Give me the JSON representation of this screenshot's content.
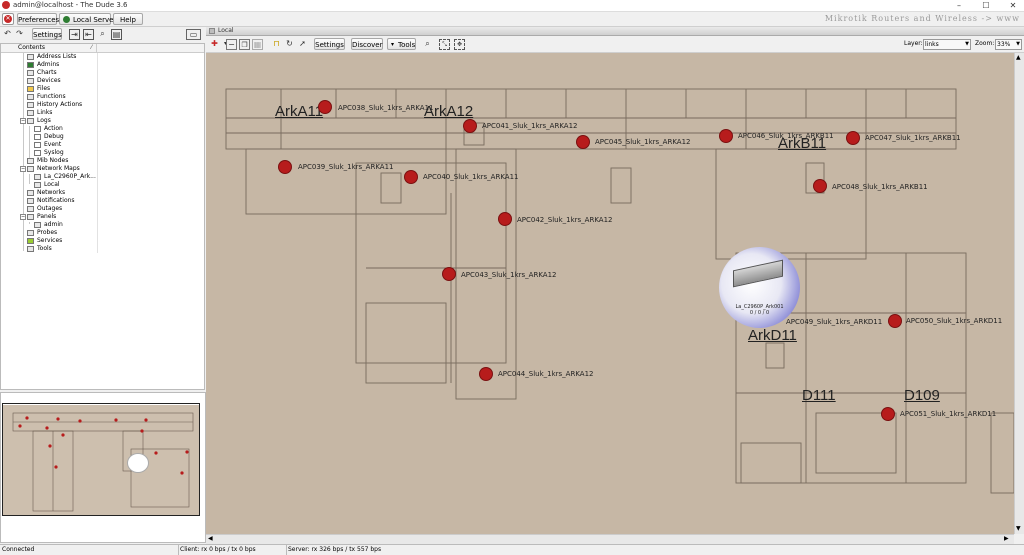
{
  "window": {
    "title": "admin@localhost - The Dude 3.6",
    "controls": [
      "–",
      "☐",
      "✕"
    ]
  },
  "toolbar": {
    "preferences": "Preferences",
    "local_server": "Local Server",
    "help": "Help",
    "brand": "Mikrotik Routers and Wireless -> www"
  },
  "left_toolbar": {
    "settings": "Settings"
  },
  "tree": {
    "header": "Contents",
    "items": [
      {
        "label": "Address Lists",
        "level": 1,
        "icon": "list-icon"
      },
      {
        "label": "Admins",
        "level": 1,
        "icon": "admin-icon"
      },
      {
        "label": "Charts",
        "level": 1,
        "icon": "chart-icon"
      },
      {
        "label": "Devices",
        "level": 1,
        "icon": "device-icon"
      },
      {
        "label": "Files",
        "level": 1,
        "icon": "folder-icon"
      },
      {
        "label": "Functions",
        "level": 1,
        "icon": "list-icon"
      },
      {
        "label": "History Actions",
        "level": 1,
        "icon": "list-icon"
      },
      {
        "label": "Links",
        "level": 1,
        "icon": "list-icon"
      },
      {
        "label": "Logs",
        "level": 1,
        "icon": "list-icon",
        "expander": "−"
      },
      {
        "label": "Action",
        "level": 2,
        "icon": "log-icon"
      },
      {
        "label": "Debug",
        "level": 2,
        "icon": "log-icon"
      },
      {
        "label": "Event",
        "level": 2,
        "icon": "log-icon"
      },
      {
        "label": "Syslog",
        "level": 2,
        "icon": "log-icon"
      },
      {
        "label": "Mib Nodes",
        "level": 1,
        "icon": "list-icon"
      },
      {
        "label": "Network Maps",
        "level": 1,
        "icon": "list-icon",
        "expander": "−"
      },
      {
        "label": "La_C2960P_Ark...",
        "level": 2,
        "icon": "map-icon"
      },
      {
        "label": "Local",
        "level": 2,
        "icon": "map-icon"
      },
      {
        "label": "Networks",
        "level": 1,
        "icon": "list-icon"
      },
      {
        "label": "Notifications",
        "level": 1,
        "icon": "list-icon"
      },
      {
        "label": "Outages",
        "level": 1,
        "icon": "list-icon"
      },
      {
        "label": "Panels",
        "level": 1,
        "icon": "list-icon",
        "expander": "−"
      },
      {
        "label": "admin",
        "level": 2,
        "icon": "panel-icon"
      },
      {
        "label": "Probes",
        "level": 1,
        "icon": "list-icon"
      },
      {
        "label": "Services",
        "level": 1,
        "icon": "service-icon"
      },
      {
        "label": "Tools",
        "level": 1,
        "icon": "list-icon"
      }
    ]
  },
  "map_window": {
    "title": "Local",
    "settings": "Settings",
    "discover": "Discover",
    "tools": "Tools",
    "layer_label": "Layer:",
    "layer_value": "links",
    "zoom_label": "Zoom:",
    "zoom_value": "33%"
  },
  "map": {
    "rooms": [
      "ArkA11",
      "ArkA12",
      "ArkB11",
      "ArkD11",
      "D111",
      "D109"
    ],
    "access_points": [
      "APC038_Sluk_1krs_ARKA11",
      "APC041_Sluk_1krs_ARKA12",
      "APC045_Sluk_1krs_ARKA12",
      "APC046_Sluk_1krs_ARKB11",
      "APC047_Sluk_1krs_ARKB11",
      "APC039_Sluk_1krs_ARKA11",
      "APC040_Sluk_1krs_ARKA11",
      "APC048_Sluk_1krs_ARKB11",
      "APC042_Sluk_1krs_ARKA12",
      "APC043_Sluk_1krs_ARKA12",
      "APC049_Sluk_1krs_ARKD11",
      "APC050_Sluk_1krs_ARKD11",
      "APC044_Sluk_1krs_ARKA12",
      "APC051_Sluk_1krs_ARKD11"
    ],
    "device": {
      "name": "La_C2960P_Ark001",
      "status": "0 / 0 / 0"
    }
  },
  "status": {
    "connection": "Connected",
    "client": "Client: rx 0 bps / tx 0 bps",
    "server": "Server: rx 326 bps / tx 557 bps"
  },
  "colors": {
    "ap_dot": "#b71c1c",
    "map_background": "#c7b8a7",
    "device_halo": "#6a6ad0"
  }
}
